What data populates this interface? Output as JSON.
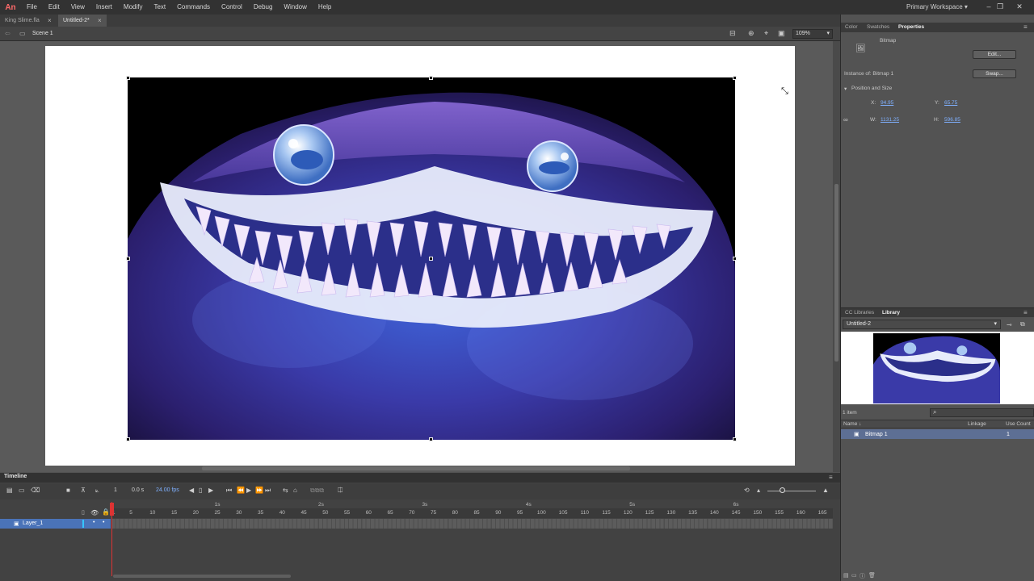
{
  "app": {
    "logo": "An"
  },
  "menubar": {
    "items": [
      "File",
      "Edit",
      "View",
      "Insert",
      "Modify",
      "Text",
      "Commands",
      "Control",
      "Debug",
      "Window",
      "Help"
    ],
    "workspace": "Primary Workspace",
    "controls": [
      "–",
      "❐",
      "✕"
    ]
  },
  "doc_tabs": [
    {
      "label": "King Slime.fla",
      "active": false
    },
    {
      "label": "Untitled-2*",
      "active": true
    }
  ],
  "scene_bar": {
    "scene": "Scene 1",
    "zoom": "109%"
  },
  "timeline": {
    "title": "Timeline",
    "current_frame": "1",
    "time": "0.0 s",
    "fps": "24.00 fps",
    "layer_name": "Layer_1",
    "frame_ticks": [
      "1",
      "5",
      "10",
      "15",
      "20",
      "25",
      "30",
      "35",
      "40",
      "45",
      "50",
      "55",
      "60",
      "65",
      "70",
      "75",
      "80",
      "85",
      "90",
      "95",
      "100",
      "105",
      "110",
      "115",
      "120",
      "125",
      "130",
      "135",
      "140",
      "145",
      "150",
      "155",
      "160",
      "165"
    ],
    "second_labels": [
      "1s",
      "2s",
      "3s",
      "4s",
      "5s",
      "6s"
    ]
  },
  "properties_panel": {
    "tabs": [
      "Color",
      "Swatches",
      "Properties"
    ],
    "active_tab": "Properties",
    "type": "Bitmap",
    "edit_label": "Edit...",
    "swap_label": "Swap...",
    "instance_of": "Instance of:  Bitmap 1",
    "section_title": "Position and Size",
    "x_label": "X:",
    "x_value": "94.95",
    "y_label": "Y:",
    "y_value": "65.75",
    "w_label": "W:",
    "w_value": "1131.25",
    "h_label": "H:",
    "h_value": "596.85"
  },
  "library_panel": {
    "tabs": [
      "CC Libraries",
      "Library"
    ],
    "active_tab": "Library",
    "document": "Untitled-2",
    "item_count": "1 item",
    "columns": [
      "Name ↓",
      "Linkage",
      "Use Count"
    ],
    "items": [
      {
        "name": "Bitmap 1",
        "linkage": "",
        "use_count": "1"
      }
    ]
  },
  "colors": {
    "accent_blue": "#4a73b8",
    "playhead": "#dd3333",
    "link_blue": "#7fb0ff"
  }
}
